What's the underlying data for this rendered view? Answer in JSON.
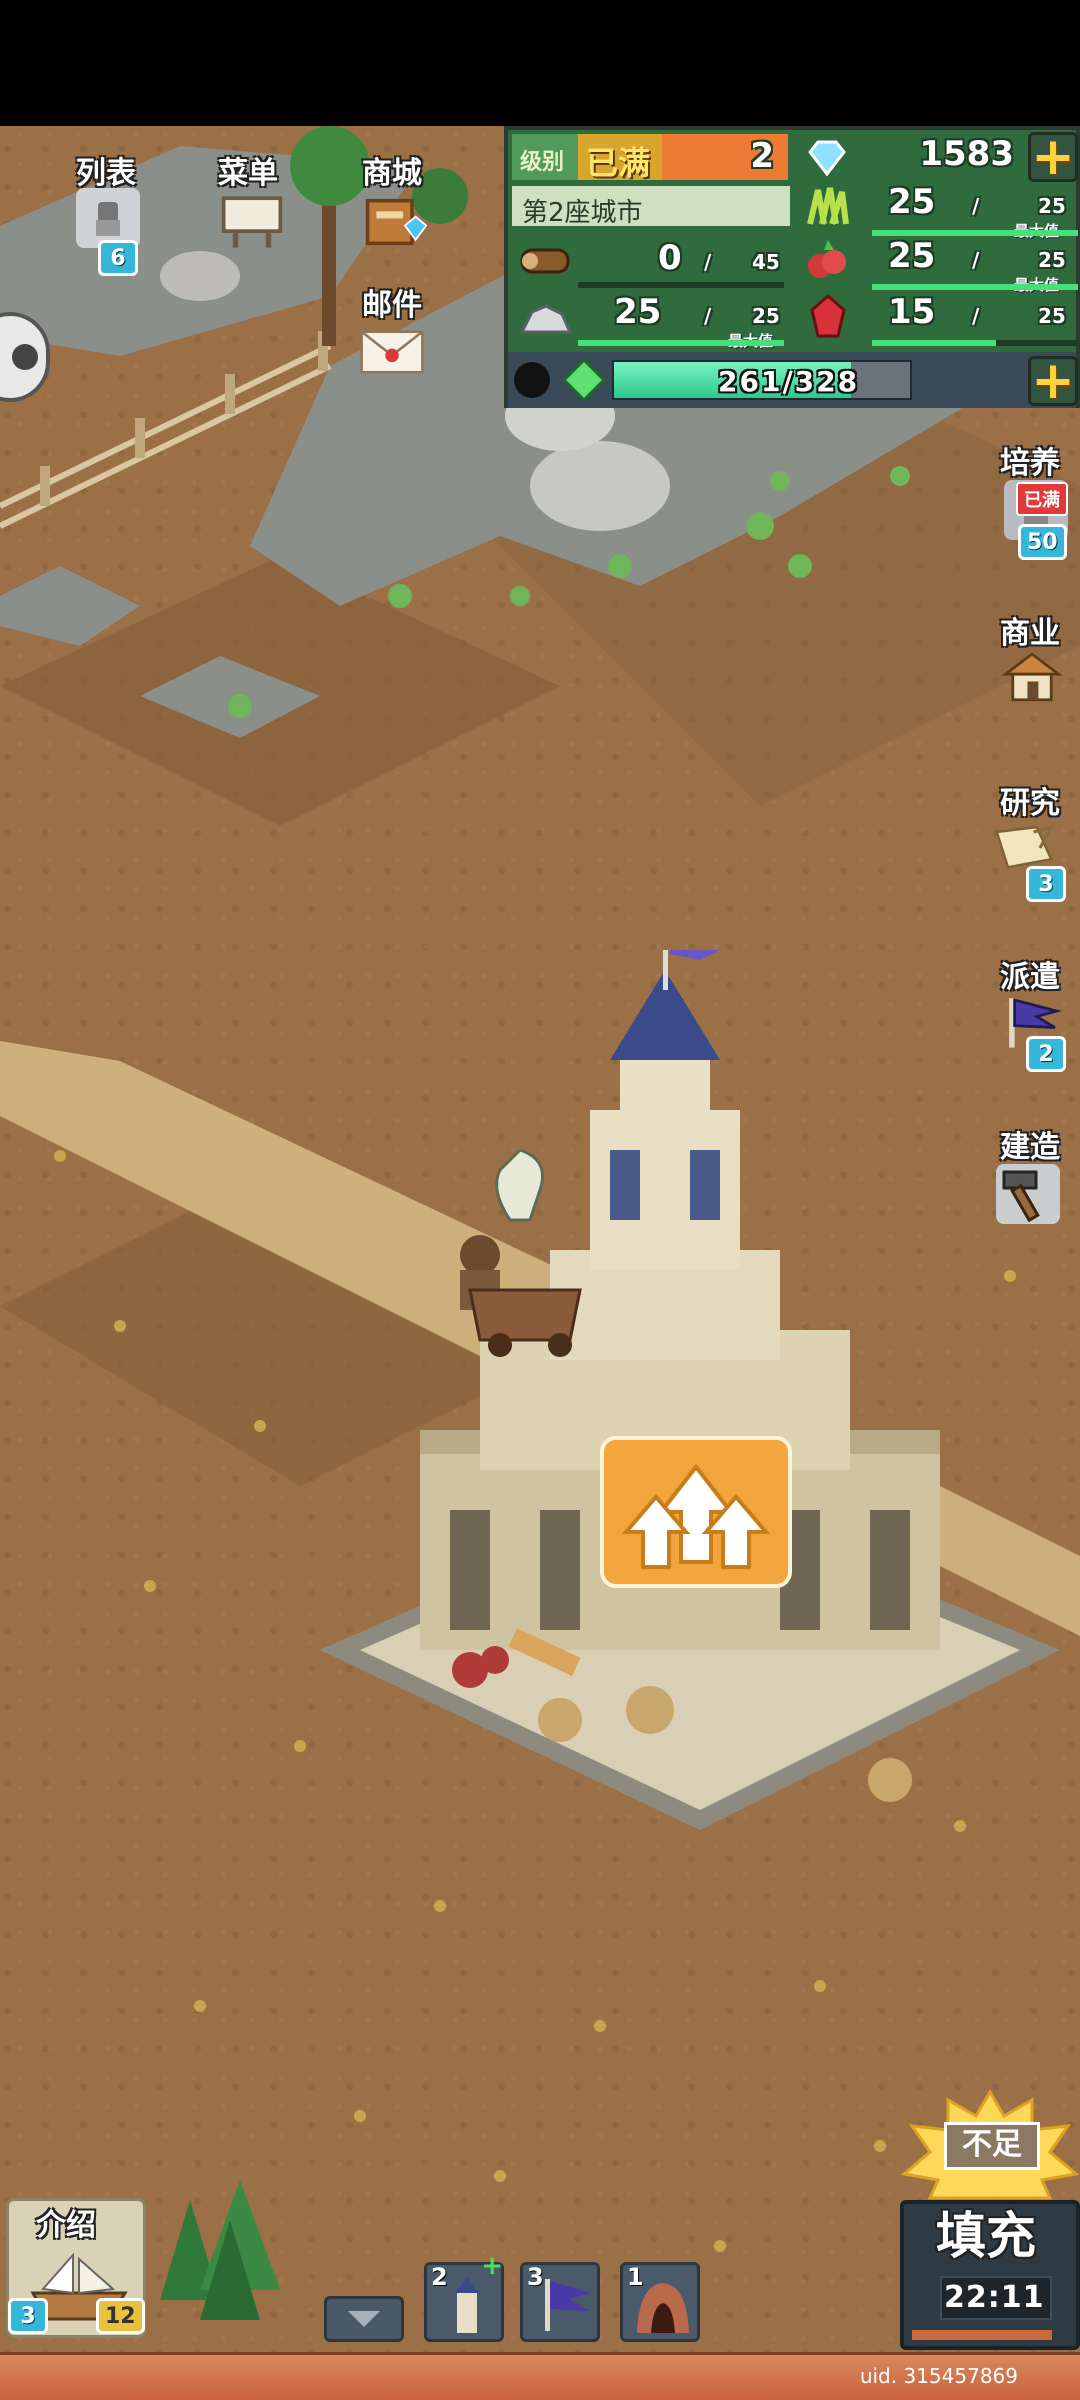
{
  "top_menu": {
    "list_label": "列表",
    "list_badge": "6",
    "menu_label": "菜单",
    "shop_label": "商城",
    "mail_label": "邮件"
  },
  "resources": {
    "level_label": "级别",
    "level_status": "已满",
    "level_value": "2",
    "gems": "1583",
    "city_name": "第2座城市",
    "grass": "25",
    "grass_max": "25",
    "wood": "0",
    "wood_max": "45",
    "food": "25",
    "food_max": "25",
    "ore": "25",
    "ore_max": "25",
    "crystal": "15",
    "crystal_max": "25",
    "max_label": "最大值",
    "energy": "261/328",
    "energy_fraction": 0.8
  },
  "side_menu": {
    "train_label": "培养",
    "train_status": "已满",
    "train_badge": "50",
    "business_label": "商业",
    "research_label": "研究",
    "research_badge": "3",
    "dispatch_label": "派遣",
    "dispatch_badge": "2",
    "build_label": "建造"
  },
  "bottom": {
    "intro_label": "介绍",
    "intro_badge_left": "3",
    "intro_badge_right": "12",
    "slot1_num": "2",
    "slot2_num": "3",
    "slot3_num": "1",
    "refill_stamp": "不足",
    "refill_label": "填充",
    "timer": "22:11"
  },
  "uid_text": "uid. 315457869",
  "colors": {
    "ground": "#9b7046",
    "panel_green": "#5aa867",
    "accent_gold": "#ffd23a",
    "badge_blue": "#35b7d9",
    "flag_purple": "#6b55c8"
  }
}
